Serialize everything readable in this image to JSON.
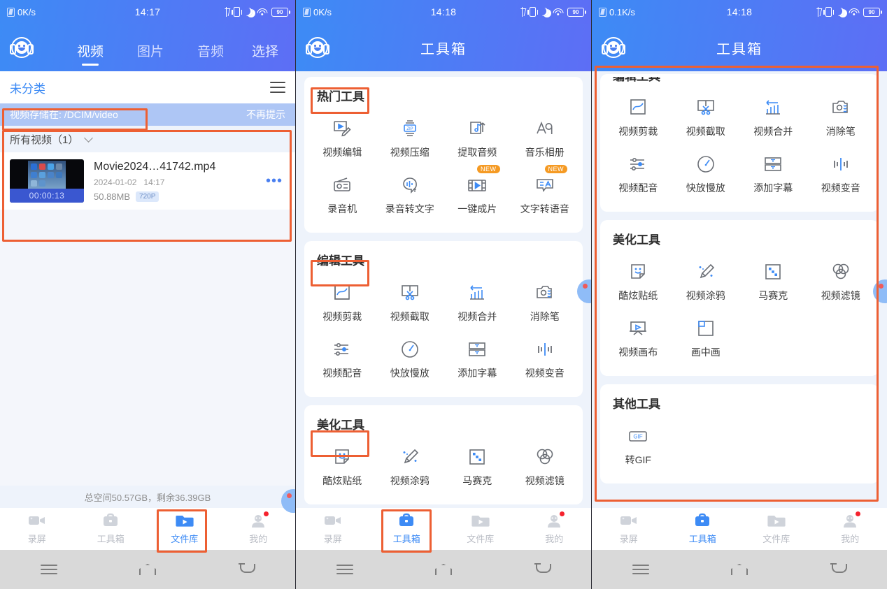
{
  "app": {
    "accent": "#3d8bf5",
    "accent2": "#5d6ef5",
    "annotation_color": "#ed5f33",
    "badge_color": "#f59a23"
  },
  "screens": [
    {
      "id": "file-library",
      "status": {
        "network": "0K/s",
        "time": "14:17",
        "battery": "90"
      },
      "header": {
        "tabs": [
          {
            "label": "视频",
            "active": true
          },
          {
            "label": "图片",
            "active": false
          },
          {
            "label": "音频",
            "active": false
          }
        ],
        "action": "选择"
      },
      "category": {
        "name": "未分类",
        "menu_icon": "hamburger-icon"
      },
      "notice": {
        "text": "视频存储在: /DCIM/video",
        "dismiss": "不再提示"
      },
      "group": {
        "label": "所有视频（1）"
      },
      "video": {
        "name": "Movie2024…41742.mp4",
        "date": "2024-01-02",
        "time": "14:17",
        "size": "50.88MB",
        "quality": "720P",
        "duration": "00:00:13",
        "more_icon": "more-dots-icon"
      },
      "storage": "总空间50.57GB，剩余36.39GB",
      "bottom_nav": [
        {
          "label": "录屏",
          "icon": "camcorder-icon",
          "active": false,
          "dot": false
        },
        {
          "label": "工具箱",
          "icon": "toolbox-icon",
          "active": false,
          "dot": false
        },
        {
          "label": "文件库",
          "icon": "file-library-icon",
          "active": true,
          "dot": false
        },
        {
          "label": "我的",
          "icon": "profile-icon",
          "active": false,
          "dot": true
        }
      ]
    },
    {
      "id": "toolbox-top",
      "status": {
        "network": "0K/s",
        "time": "14:18",
        "battery": "90"
      },
      "header": {
        "title": "工具箱"
      },
      "sections": [
        {
          "title": "热门工具",
          "tools": [
            {
              "label": "视频编辑",
              "icon": "video-edit-icon",
              "new": false
            },
            {
              "label": "视频压缩",
              "icon": "zip-compress-icon",
              "new": false
            },
            {
              "label": "提取音频",
              "icon": "extract-audio-icon",
              "new": false
            },
            {
              "label": "音乐相册",
              "icon": "music-album-icon",
              "new": false
            },
            {
              "label": "录音机",
              "icon": "recorder-icon",
              "new": false
            },
            {
              "label": "录音转文字",
              "icon": "speech-to-text-icon",
              "new": false
            },
            {
              "label": "一键成片",
              "icon": "one-click-film-icon",
              "new": true
            },
            {
              "label": "文字转语音",
              "icon": "text-to-speech-icon",
              "new": true
            }
          ]
        },
        {
          "title": "编辑工具",
          "tools": [
            {
              "label": "视频剪裁",
              "icon": "video-crop-icon",
              "new": false
            },
            {
              "label": "视频截取",
              "icon": "video-cut-icon",
              "new": false
            },
            {
              "label": "视频合并",
              "icon": "video-merge-icon",
              "new": false
            },
            {
              "label": "消除笔",
              "icon": "eraser-pen-icon",
              "new": false
            },
            {
              "label": "视频配音",
              "icon": "video-dub-icon",
              "new": false
            },
            {
              "label": "快放慢放",
              "icon": "speed-icon",
              "new": false
            },
            {
              "label": "添加字幕",
              "icon": "subtitle-icon",
              "new": false
            },
            {
              "label": "视频变音",
              "icon": "voice-change-icon",
              "new": false
            }
          ]
        },
        {
          "title": "美化工具",
          "tools": [
            {
              "label": "酷炫贴纸",
              "icon": "sticker-icon",
              "new": false
            },
            {
              "label": "视频涂鸦",
              "icon": "doodle-brush-icon",
              "new": false
            },
            {
              "label": "马赛克",
              "icon": "mosaic-icon",
              "new": false
            },
            {
              "label": "视频滤镜",
              "icon": "filter-icon",
              "new": false
            }
          ]
        }
      ],
      "bottom_nav": [
        {
          "label": "录屏",
          "icon": "camcorder-icon",
          "active": false,
          "dot": false
        },
        {
          "label": "工具箱",
          "icon": "toolbox-icon",
          "active": true,
          "dot": false
        },
        {
          "label": "文件库",
          "icon": "file-library-icon",
          "active": false,
          "dot": false
        },
        {
          "label": "我的",
          "icon": "profile-icon",
          "active": false,
          "dot": true
        }
      ]
    },
    {
      "id": "toolbox-scrolled",
      "status": {
        "network": "0.1K/s",
        "time": "14:18",
        "battery": "90"
      },
      "header": {
        "title": "工具箱"
      },
      "sections": [
        {
          "title": "编辑工具",
          "clipped": true,
          "tools": [
            {
              "label": "视频剪裁",
              "icon": "video-crop-icon",
              "new": false
            },
            {
              "label": "视频截取",
              "icon": "video-cut-icon",
              "new": false
            },
            {
              "label": "视频合并",
              "icon": "video-merge-icon",
              "new": false
            },
            {
              "label": "消除笔",
              "icon": "eraser-pen-icon",
              "new": false
            },
            {
              "label": "视频配音",
              "icon": "video-dub-icon",
              "new": false
            },
            {
              "label": "快放慢放",
              "icon": "speed-icon",
              "new": false
            },
            {
              "label": "添加字幕",
              "icon": "subtitle-icon",
              "new": false
            },
            {
              "label": "视频变音",
              "icon": "voice-change-icon",
              "new": false
            }
          ]
        },
        {
          "title": "美化工具",
          "clipped": false,
          "tools": [
            {
              "label": "酷炫贴纸",
              "icon": "sticker-icon",
              "new": false
            },
            {
              "label": "视频涂鸦",
              "icon": "doodle-brush-icon",
              "new": false
            },
            {
              "label": "马赛克",
              "icon": "mosaic-icon",
              "new": false
            },
            {
              "label": "视频滤镜",
              "icon": "filter-icon",
              "new": false
            },
            {
              "label": "视频画布",
              "icon": "video-canvas-icon",
              "new": false
            },
            {
              "label": "画中画",
              "icon": "picture-in-picture-icon",
              "new": false
            }
          ]
        },
        {
          "title": "其他工具",
          "clipped": false,
          "tools": [
            {
              "label": "转GIF",
              "icon": "gif-icon",
              "new": false
            }
          ]
        }
      ],
      "bottom_nav": [
        {
          "label": "录屏",
          "icon": "camcorder-icon",
          "active": false,
          "dot": false
        },
        {
          "label": "工具箱",
          "icon": "toolbox-icon",
          "active": true,
          "dot": false
        },
        {
          "label": "文件库",
          "icon": "file-library-icon",
          "active": false,
          "dot": false
        },
        {
          "label": "我的",
          "icon": "profile-icon",
          "active": false,
          "dot": true
        }
      ]
    }
  ],
  "system_nav": {
    "menu": "menu-icon",
    "home": "home-icon",
    "back": "back-icon"
  }
}
